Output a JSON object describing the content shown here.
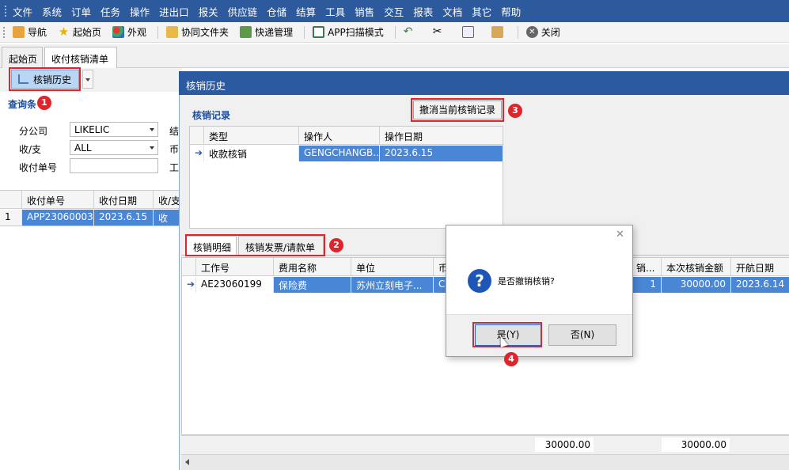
{
  "menu": [
    "文件",
    "系统",
    "订单",
    "任务",
    "操作",
    "进出口",
    "报关",
    "供应链",
    "仓储",
    "结算",
    "工具",
    "销售",
    "交互",
    "报表",
    "文档",
    "其它",
    "帮助"
  ],
  "toolbar": {
    "nav": "导航",
    "home": "起始页",
    "look": "外观",
    "shared_folder": "协同文件夹",
    "express": "快递管理",
    "app_scan": "APP扫描模式",
    "close": "关闭"
  },
  "tabs": [
    "起始页",
    "收付核销清单"
  ],
  "left": {
    "history_btn": "核销历史",
    "query_title": "查询条",
    "branch_label": "分公司",
    "branch_value": "LIKELIC",
    "inout_label": "收/支",
    "inout_value": "ALL",
    "docno_label": "收付单号",
    "cut1": "结",
    "cut2": "币",
    "cut3": "工",
    "grid_headers": [
      "收付单号",
      "收付日期",
      "收/支"
    ],
    "grid_row": {
      "num": "1",
      "docno": "APP23060003",
      "date": "2023.6.15",
      "io": "收"
    }
  },
  "history": {
    "title": "核销历史",
    "records_title": "核销记录",
    "cancel_btn": "撤消当前核销记录",
    "rec_headers": [
      "类型",
      "操作人",
      "操作日期"
    ],
    "rec_row": {
      "type": "收款核销",
      "operator": "GENGCHANGB...",
      "date": "2023.6.15"
    },
    "subtabs": [
      "核销明细",
      "核销发票/请款单"
    ],
    "det_headers": [
      "工作号",
      "费用名称",
      "单位",
      "币",
      "销...",
      "本次核销金额",
      "开航日期"
    ],
    "det_row": {
      "job": "AE23060199",
      "fee": "保险费",
      "unit": "苏州立刻电子...",
      "cur": "C",
      "cnt": "1",
      "amount": "30000.00",
      "sail": "2023.6.14"
    },
    "sum1": "30000.00",
    "sum2": "30000.00"
  },
  "dialog": {
    "message": "是否撤销核销?",
    "yes": "是(Y)",
    "no": "否(N)"
  },
  "badges": [
    "1",
    "2",
    "3",
    "4"
  ]
}
